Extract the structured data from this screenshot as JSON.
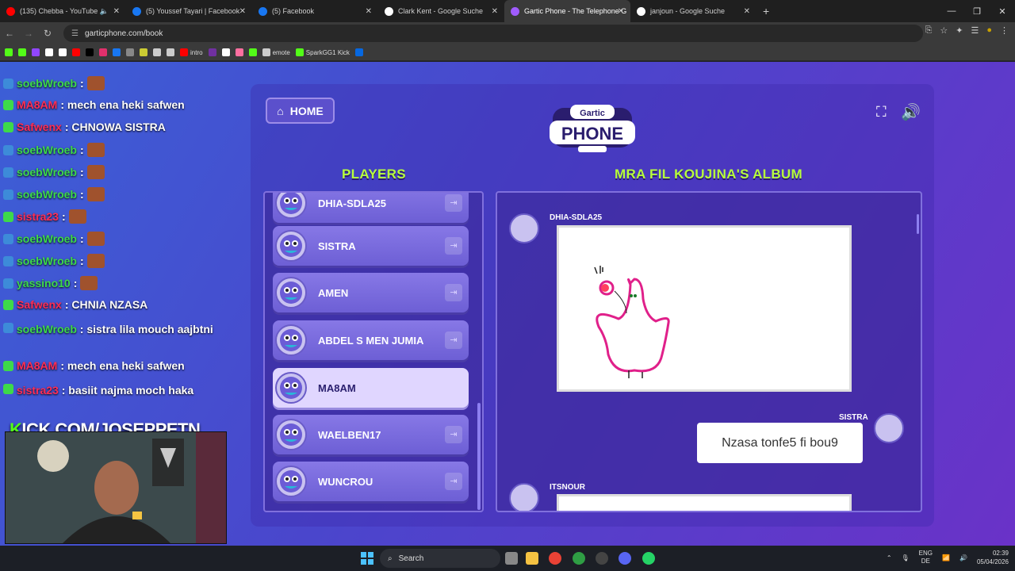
{
  "browser": {
    "tabs": [
      {
        "title": "(135) Chebba - YouTube",
        "color": "#ff0000"
      },
      {
        "title": "(5) Youssef Tayari | Facebook",
        "color": "#1877f2"
      },
      {
        "title": "(5) Facebook",
        "color": "#1877f2"
      },
      {
        "title": "Clark Kent - Google Suche",
        "color": "#ffffff"
      },
      {
        "title": "Gartic Phone - The Telephone G",
        "color": "#a05cff"
      },
      {
        "title": "janjoun - Google Suche",
        "color": "#ffffff"
      }
    ],
    "url": "garticphone.com/book",
    "bookmarks": [
      {
        "label": "",
        "color": "#53fc18"
      },
      {
        "label": "",
        "color": "#53fc18"
      },
      {
        "label": "",
        "color": "#9146ff"
      },
      {
        "label": "",
        "color": "#ffffff"
      },
      {
        "label": "",
        "color": "#ffffff"
      },
      {
        "label": "",
        "color": "#ff0000"
      },
      {
        "label": "",
        "color": "#000000"
      },
      {
        "label": "",
        "color": "#e1306c"
      },
      {
        "label": "",
        "color": "#1877f2"
      },
      {
        "label": "",
        "color": "#888888"
      },
      {
        "label": "",
        "color": "#cccc33"
      },
      {
        "label": "",
        "color": "#cccccc"
      },
      {
        "label": "",
        "color": "#cccccc"
      },
      {
        "label": "intro",
        "color": "#ff0000"
      },
      {
        "label": "",
        "color": "#7030a0"
      },
      {
        "label": "",
        "color": "#ffffff"
      },
      {
        "label": "",
        "color": "#ff6fa0"
      },
      {
        "label": "",
        "color": "#53fc18"
      },
      {
        "label": "emote",
        "color": "#cccccc"
      },
      {
        "label": "SparkGG1 Kick",
        "color": "#53fc18"
      },
      {
        "label": "",
        "color": "#0668e1"
      }
    ]
  },
  "chat": {
    "lines": [
      {
        "user": "soebWroeb",
        "user_color": "#3dd94a",
        "msg": ":",
        "emote": true,
        "wrap": false
      },
      {
        "user": "MA8AM",
        "user_color": "#ff2d55",
        "msg": ": mech ena heki safwen",
        "emote": false,
        "wrap": false
      },
      {
        "user": "Safwenx",
        "user_color": "#ff2d55",
        "msg": ": CHNOWA SISTRA",
        "emote": false,
        "wrap": false
      },
      {
        "user": "soebWroeb",
        "user_color": "#3dd94a",
        "msg": ":",
        "emote": true,
        "wrap": false
      },
      {
        "user": "soebWroeb",
        "user_color": "#3dd94a",
        "msg": ":",
        "emote": true,
        "wrap": false
      },
      {
        "user": "soebWroeb",
        "user_color": "#3dd94a",
        "msg": ":",
        "emote": true,
        "wrap": false
      },
      {
        "user": "sistra23",
        "user_color": "#ff2d55",
        "msg": ":",
        "emote": true,
        "wrap": false
      },
      {
        "user": "soebWroeb",
        "user_color": "#3dd94a",
        "msg": ":",
        "emote": true,
        "wrap": false
      },
      {
        "user": "soebWroeb",
        "user_color": "#3dd94a",
        "msg": ":",
        "emote": true,
        "wrap": false
      },
      {
        "user": "yassino10",
        "user_color": "#3dd94a",
        "msg": ":",
        "emote": true,
        "wrap": false
      },
      {
        "user": "Safwenx",
        "user_color": "#ff2d55",
        "msg": ": CHNIA NZASA",
        "emote": false,
        "wrap": false
      },
      {
        "user": "soebWroeb",
        "user_color": "#3dd94a",
        "msg": ": sistra lila mouch aajbtni",
        "emote": false,
        "wrap": true
      },
      {
        "user": "MA8AM",
        "user_color": "#ff2d55",
        "msg": ": mech ena heki safwen",
        "emote": false,
        "wrap": false
      },
      {
        "user": "sistra23",
        "user_color": "#ff2d55",
        "msg": ": basiit najma moch haka",
        "emote": false,
        "wrap": true
      }
    ],
    "kick_banner_prefix": "K",
    "kick_banner_rest": "ICK.COM/JOSEPPETN"
  },
  "game": {
    "home_label": "HOME",
    "logo_top": "Gartic",
    "logo_bottom": "PHONE",
    "players_heading": "PLAYERS",
    "album_heading": "MRA FIL KOUJINA'S ALBUM",
    "players": [
      {
        "name": "DHIA-SDLA25",
        "me": false
      },
      {
        "name": "SISTRA",
        "me": false
      },
      {
        "name": "AMEN",
        "me": false
      },
      {
        "name": "ABDEL S MEN JUMIA",
        "me": false
      },
      {
        "name": "MA8AM",
        "me": true
      },
      {
        "name": "WAELBEN17",
        "me": false
      },
      {
        "name": "WUNCROU",
        "me": false
      }
    ],
    "album": {
      "entry1_author": "DHIA-SDLA25",
      "entry2_author": "SISTRA",
      "entry2_text": "Nzasa tonfe5 fi bou9",
      "entry3_author": "ITSNOUR"
    }
  },
  "taskbar": {
    "search_label": "Search",
    "lang_top": "ENG",
    "lang_bottom": "DE",
    "time": "02:39",
    "date": "05/04/2026"
  }
}
